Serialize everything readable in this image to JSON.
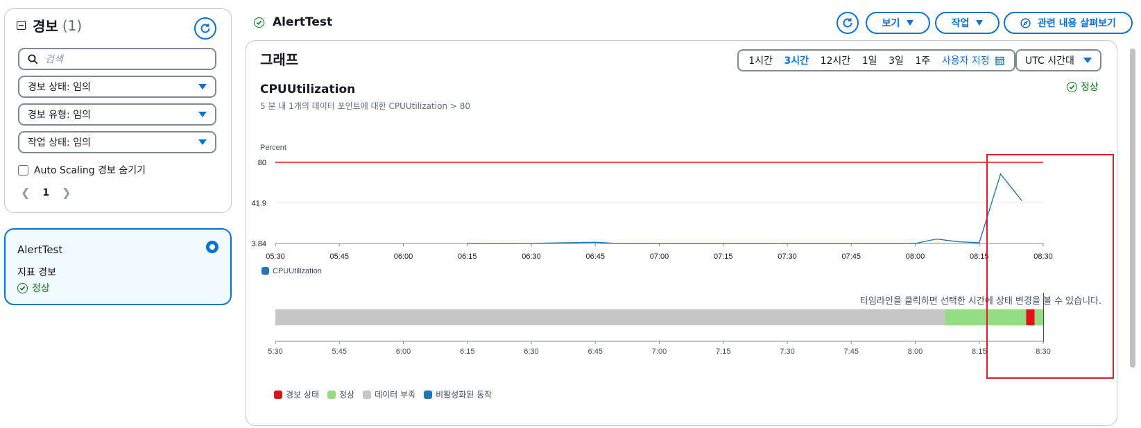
{
  "filters": {
    "title": "경보",
    "count": "(1)",
    "search_placeholder": "검색",
    "alarm_state_select": "경보 상태: 임의",
    "alarm_type_select": "경보 유형: 임의",
    "action_state_select": "작업 상태: 임의",
    "autoscaling_checkbox_label": "Auto Scaling 경보 숨기기",
    "page_number": "1"
  },
  "alarm_card": {
    "name": "AlertTest",
    "type": "지표 경보",
    "status": "정상"
  },
  "header": {
    "title": "AlertTest",
    "view_button": "보기",
    "actions_button": "작업",
    "explore_related_button": "관련 내용 살펴보기"
  },
  "graph": {
    "section_title": "그래프",
    "time_ranges": [
      "1시간",
      "3시간",
      "12시간",
      "1일",
      "3일",
      "1주"
    ],
    "active_time_range": "3시간",
    "custom_range_label": "사용자 지정",
    "timezone_select": "UTC 시간대",
    "metric_name": "CPUUtilization",
    "metric_description": "5 분 내 1개의 데이터 포인트에 대한 CPUUtilization > 80",
    "metric_status": "정상",
    "timeline_note": "타임라인을 클릭하면 선택한 시간에 상태 변경을 볼 수 있습니다.",
    "timeline_legend": [
      {
        "label": "경보 상태",
        "color": "#d91515"
      },
      {
        "label": "정상",
        "color": "#95dd83"
      },
      {
        "label": "데이터 부족",
        "color": "#c6c6c6"
      },
      {
        "label": "비활성화된 동작",
        "color": "#1f77b4"
      }
    ],
    "timeline_ticks": [
      "5:30",
      "5:45",
      "6:00",
      "6:15",
      "6:30",
      "6:45",
      "7:00",
      "7:15",
      "7:30",
      "7:45",
      "8:00",
      "8:15",
      "8:30"
    ],
    "timeline_segments": [
      {
        "state": "데이터 부족",
        "from": "5:30",
        "to": "8:07"
      },
      {
        "state": "정상",
        "from": "8:07",
        "to": "8:26"
      },
      {
        "state": "경보 상태",
        "from": "8:26",
        "to": "8:28"
      },
      {
        "state": "정상",
        "from": "8:28",
        "to": "8:30"
      }
    ]
  },
  "colors": {
    "accent": "#0972d3",
    "ok_green": "#037f0c",
    "threshold_red": "#d91515",
    "series_blue": "#1f77b4",
    "highlight_box": "#e01b24"
  },
  "chart_data": {
    "type": "line",
    "title": "CPUUtilization",
    "ylabel": "Percent",
    "xlabel": "",
    "x_ticks": [
      "05:30",
      "05:45",
      "06:00",
      "06:15",
      "06:30",
      "06:45",
      "07:00",
      "07:15",
      "07:30",
      "07:45",
      "08:00",
      "08:15",
      "08:30"
    ],
    "y_ticks": [
      3.84,
      41.9,
      80
    ],
    "ylim": [
      3.84,
      80
    ],
    "threshold": {
      "value": 80,
      "color": "#d91515"
    },
    "legend": [
      "CPUUtilization"
    ],
    "series": [
      {
        "name": "CPUUtilization",
        "color": "#1f77b4",
        "points": [
          {
            "x": "06:15",
            "y": 3.9
          },
          {
            "x": "06:30",
            "y": 3.95
          },
          {
            "x": "06:45",
            "y": 5.0
          },
          {
            "x": "06:50",
            "y": 3.9
          },
          {
            "x": "07:00",
            "y": 3.9
          },
          {
            "x": "07:15",
            "y": 3.9
          },
          {
            "x": "07:30",
            "y": 3.9
          },
          {
            "x": "07:45",
            "y": 3.9
          },
          {
            "x": "08:00",
            "y": 3.9
          },
          {
            "x": "08:05",
            "y": 8.0
          },
          {
            "x": "08:10",
            "y": 5.5
          },
          {
            "x": "08:15",
            "y": 4.5
          },
          {
            "x": "08:20",
            "y": 69.0
          },
          {
            "x": "08:25",
            "y": 44.0
          }
        ]
      }
    ]
  }
}
